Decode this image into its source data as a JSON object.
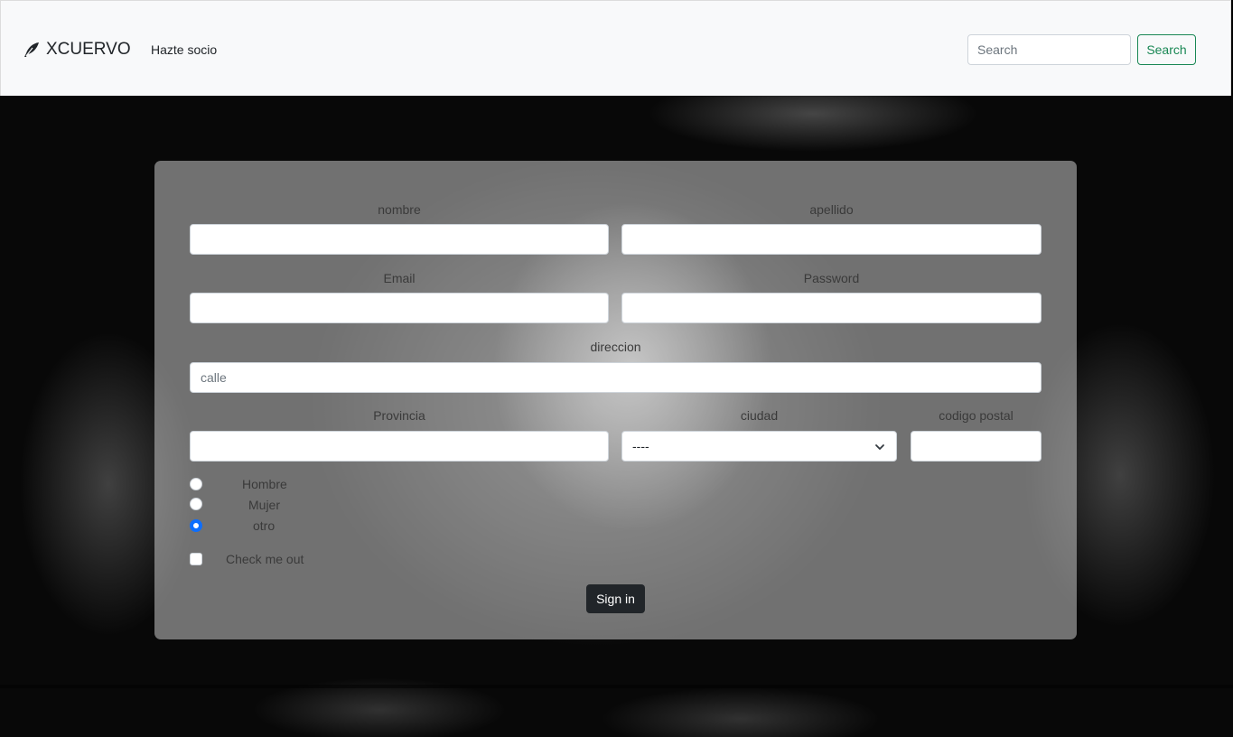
{
  "navbar": {
    "brand": "XCUERVO",
    "brand_icon": "feather-icon",
    "link": "Hazte socio",
    "search_placeholder": "Search",
    "search_button": "Search",
    "accent": "#198754"
  },
  "form": {
    "nombre_label": "nombre",
    "apellido_label": "apellido",
    "email_label": "Email",
    "password_label": "Password",
    "direccion_label": "direccion",
    "calle_placeholder": "calle",
    "provincia_label": "Provincia",
    "ciudad_label": "ciudad",
    "ciudad_selected": "----",
    "codigo_postal_label": "codigo postal",
    "gender_options": [
      "Hombre",
      "Mujer",
      "otro"
    ],
    "gender_selected": "otro",
    "checkbox_label": "Check me out",
    "submit_label": "Sign in",
    "radio_accent": "#0d6efd"
  }
}
